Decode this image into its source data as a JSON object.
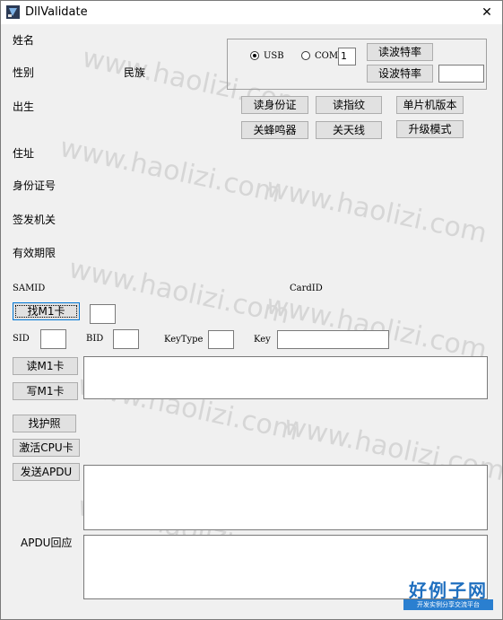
{
  "window": {
    "title": "DllValidate",
    "close_glyph": "✕"
  },
  "labels": {
    "name": "姓名",
    "sex": "性别",
    "nation": "民族",
    "birth": "出生",
    "address": "住址",
    "id_number": "身份证号",
    "issuer": "签发机关",
    "validity": "有效期限",
    "samid": "SAMID",
    "cardid": "CardID",
    "sid": "SID",
    "bid": "BID",
    "keytype": "KeyType",
    "key": "Key",
    "apdu_response": "APDU回应"
  },
  "port": {
    "usb_label": "USB",
    "com_label": "COM",
    "selected": "USB",
    "com_number": "1"
  },
  "buttons": {
    "read_baud": "读波特率",
    "set_baud": "设波特率",
    "read_id": "读身份证",
    "read_finger": "读指纹",
    "mcu_version": "单片机版本",
    "beeper_off": "关蜂鸣器",
    "antenna_off": "关天线",
    "upgrade_mode": "升级模式",
    "find_m1": "找M1卡",
    "read_m1": "读M1卡",
    "write_m1": "写M1卡",
    "find_passport": "找护照",
    "activate_cpu": "激活CPU卡",
    "send_apdu": "发送APDU"
  },
  "watermark": {
    "text": "www.haolizi.com"
  },
  "logo": {
    "main": "好例子网",
    "sub": "开发实例分享交流平台"
  },
  "colors": {
    "watermark": "#d6d6d6",
    "logo_blue": "#1f6fbf",
    "focus_border": "#0078d7"
  }
}
